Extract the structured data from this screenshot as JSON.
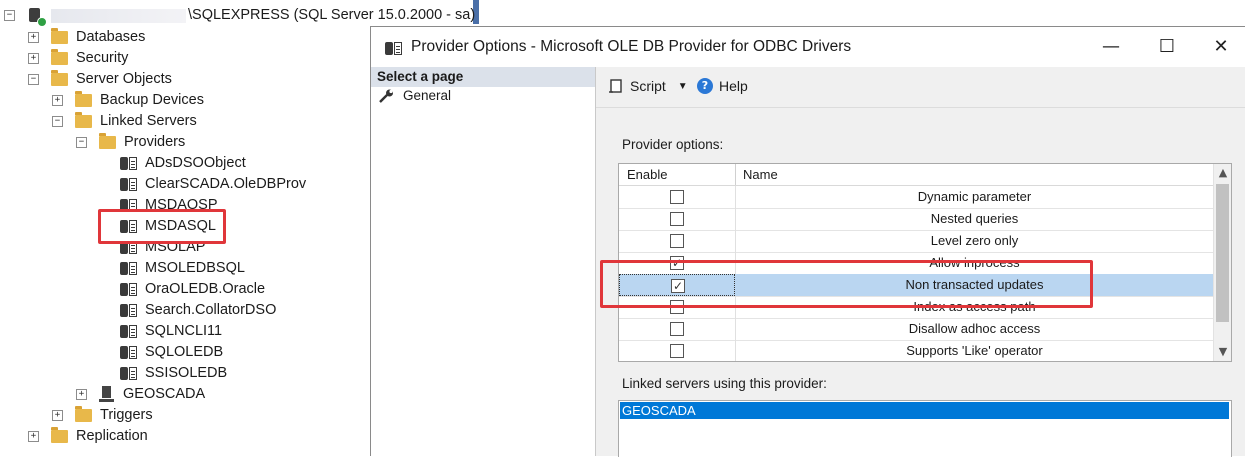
{
  "explorer": {
    "server_label": "\\SQLEXPRESS (SQL Server 15.0.2000 - sa)",
    "nodes": {
      "databases": "Databases",
      "security": "Security",
      "server_objects": "Server Objects",
      "backup_devices": "Backup Devices",
      "linked_servers": "Linked Servers",
      "providers": "Providers",
      "p0": "ADsDSOObject",
      "p1": "ClearSCADA.OleDBProv",
      "p2": "MSDAOSP",
      "p3": "MSDASQL",
      "p4": "MSOLAP",
      "p5": "MSOLEDBSQL",
      "p6": "OraOLEDB.Oracle",
      "p7": "Search.CollatorDSO",
      "p8": "SQLNCLI11",
      "p9": "SQLOLEDB",
      "p10": "SSISOLEDB",
      "geoscada": "GEOSCADA",
      "triggers": "Triggers",
      "replication": "Replication"
    }
  },
  "dialog": {
    "title": "Provider Options - Microsoft OLE DB Provider for ODBC Drivers",
    "window_buttons": {
      "minimize": "—",
      "maximize": "☐",
      "close": "✕"
    },
    "select_page_header": "Select a page",
    "pages": {
      "general": "General"
    },
    "toolbar": {
      "script": "Script",
      "help": "Help"
    },
    "provider_options_label": "Provider options:",
    "grid": {
      "columns": {
        "enable": "Enable",
        "name": "Name"
      },
      "rows": [
        {
          "name": "Dynamic parameter",
          "checked": ""
        },
        {
          "name": "Nested queries",
          "checked": ""
        },
        {
          "name": "Level zero only",
          "checked": ""
        },
        {
          "name": "Allow inprocess",
          "checked": "✓"
        },
        {
          "name": "Non transacted updates",
          "checked": "✓"
        },
        {
          "name": "Index as access path",
          "checked": ""
        },
        {
          "name": "Disallow adhoc access",
          "checked": ""
        },
        {
          "name": "Supports 'Like' operator",
          "checked": ""
        }
      ]
    },
    "linked_servers_label": "Linked servers using this provider:",
    "linked_servers": [
      "GEOSCADA"
    ]
  },
  "colors": {
    "highlight": "#e0363a",
    "selection": "#bad6f1",
    "list_selection": "#0078d7"
  }
}
